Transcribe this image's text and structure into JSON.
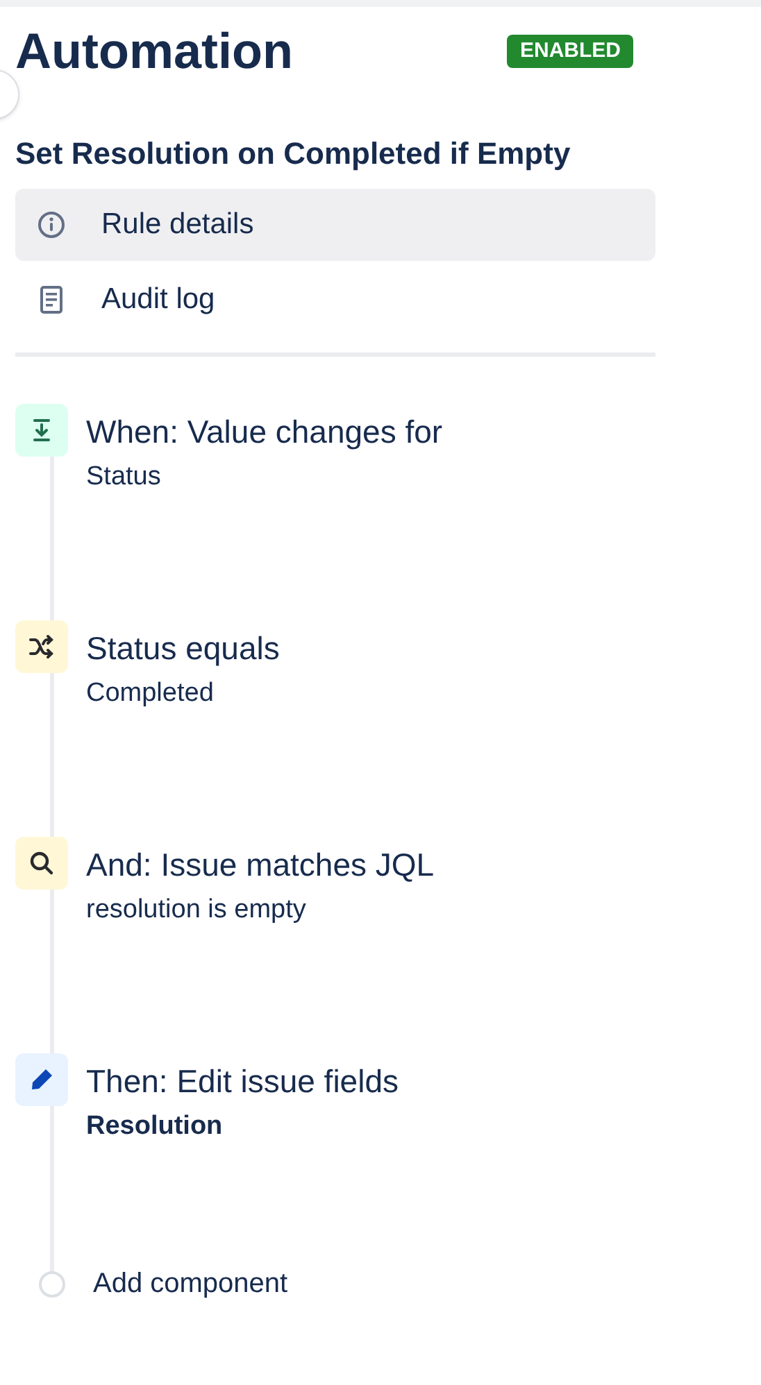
{
  "header": {
    "title": "Automation",
    "status_badge": "ENABLED"
  },
  "rule_name": "Set Resolution on Completed if Empty",
  "nav": [
    {
      "label": "Rule details",
      "kind": "info",
      "selected": true
    },
    {
      "label": "Audit log",
      "kind": "log",
      "selected": false
    }
  ],
  "steps": [
    {
      "kind": "trigger",
      "title": "When: Value changes for",
      "detail": "Status"
    },
    {
      "kind": "condition",
      "title": "Status equals",
      "detail": "Completed"
    },
    {
      "kind": "search",
      "title": "And: Issue matches JQL",
      "detail": "resolution is empty"
    },
    {
      "kind": "action",
      "title": "Then: Edit issue fields",
      "detail": "Resolution"
    }
  ],
  "add_component": "Add component"
}
